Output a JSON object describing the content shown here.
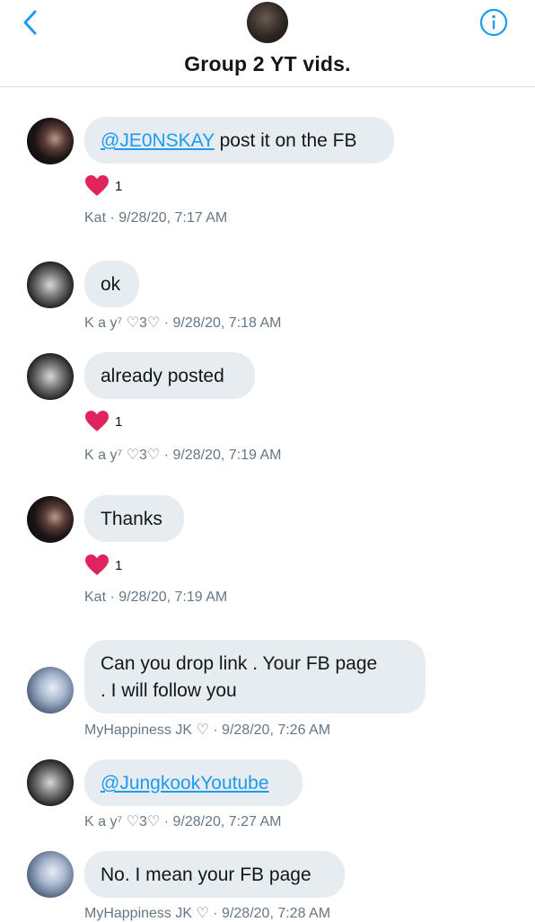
{
  "header": {
    "title": "Group 2 YT vids."
  },
  "messages": [
    {
      "sender": "Kat",
      "mention": "@JE0NSKAY",
      "text": " post it on the FB",
      "reactions": "1",
      "meta": "Kat  · 9/28/20, 7:17 AM"
    },
    {
      "sender": "Kay",
      "text": "ok",
      "meta": "K a y⁷ ♡3♡  · 9/28/20, 7:18 AM"
    },
    {
      "sender": "Kay",
      "text": "already posted",
      "reactions": "1",
      "meta": "K a y⁷ ♡3♡  · 9/28/20, 7:19 AM"
    },
    {
      "sender": "Kat",
      "text": "Thanks",
      "reactions": "1",
      "meta": "Kat  · 9/28/20, 7:19 AM"
    },
    {
      "sender": "MyHappiness",
      "text_line1": "Can you drop link . Your FB page",
      "text_line2": ". I will follow you",
      "meta": "MyHappiness JK ♡  · 9/28/20, 7:26 AM"
    },
    {
      "sender": "Kay",
      "mention": "@JungkookYoutube",
      "meta": "K a y⁷ ♡3♡  · 9/28/20, 7:27 AM"
    },
    {
      "sender": "MyHappiness",
      "text": "No. I mean your FB page",
      "meta": "MyHappiness JK ♡  · 9/28/20, 7:28 AM"
    }
  ],
  "colors": {
    "accent": "#1d9bf0",
    "bubble": "#e6ecf0",
    "heart": "#e0245e",
    "meta": "#657786"
  },
  "icons": [
    "back-chevron-icon",
    "info-icon",
    "heart-icon"
  ]
}
